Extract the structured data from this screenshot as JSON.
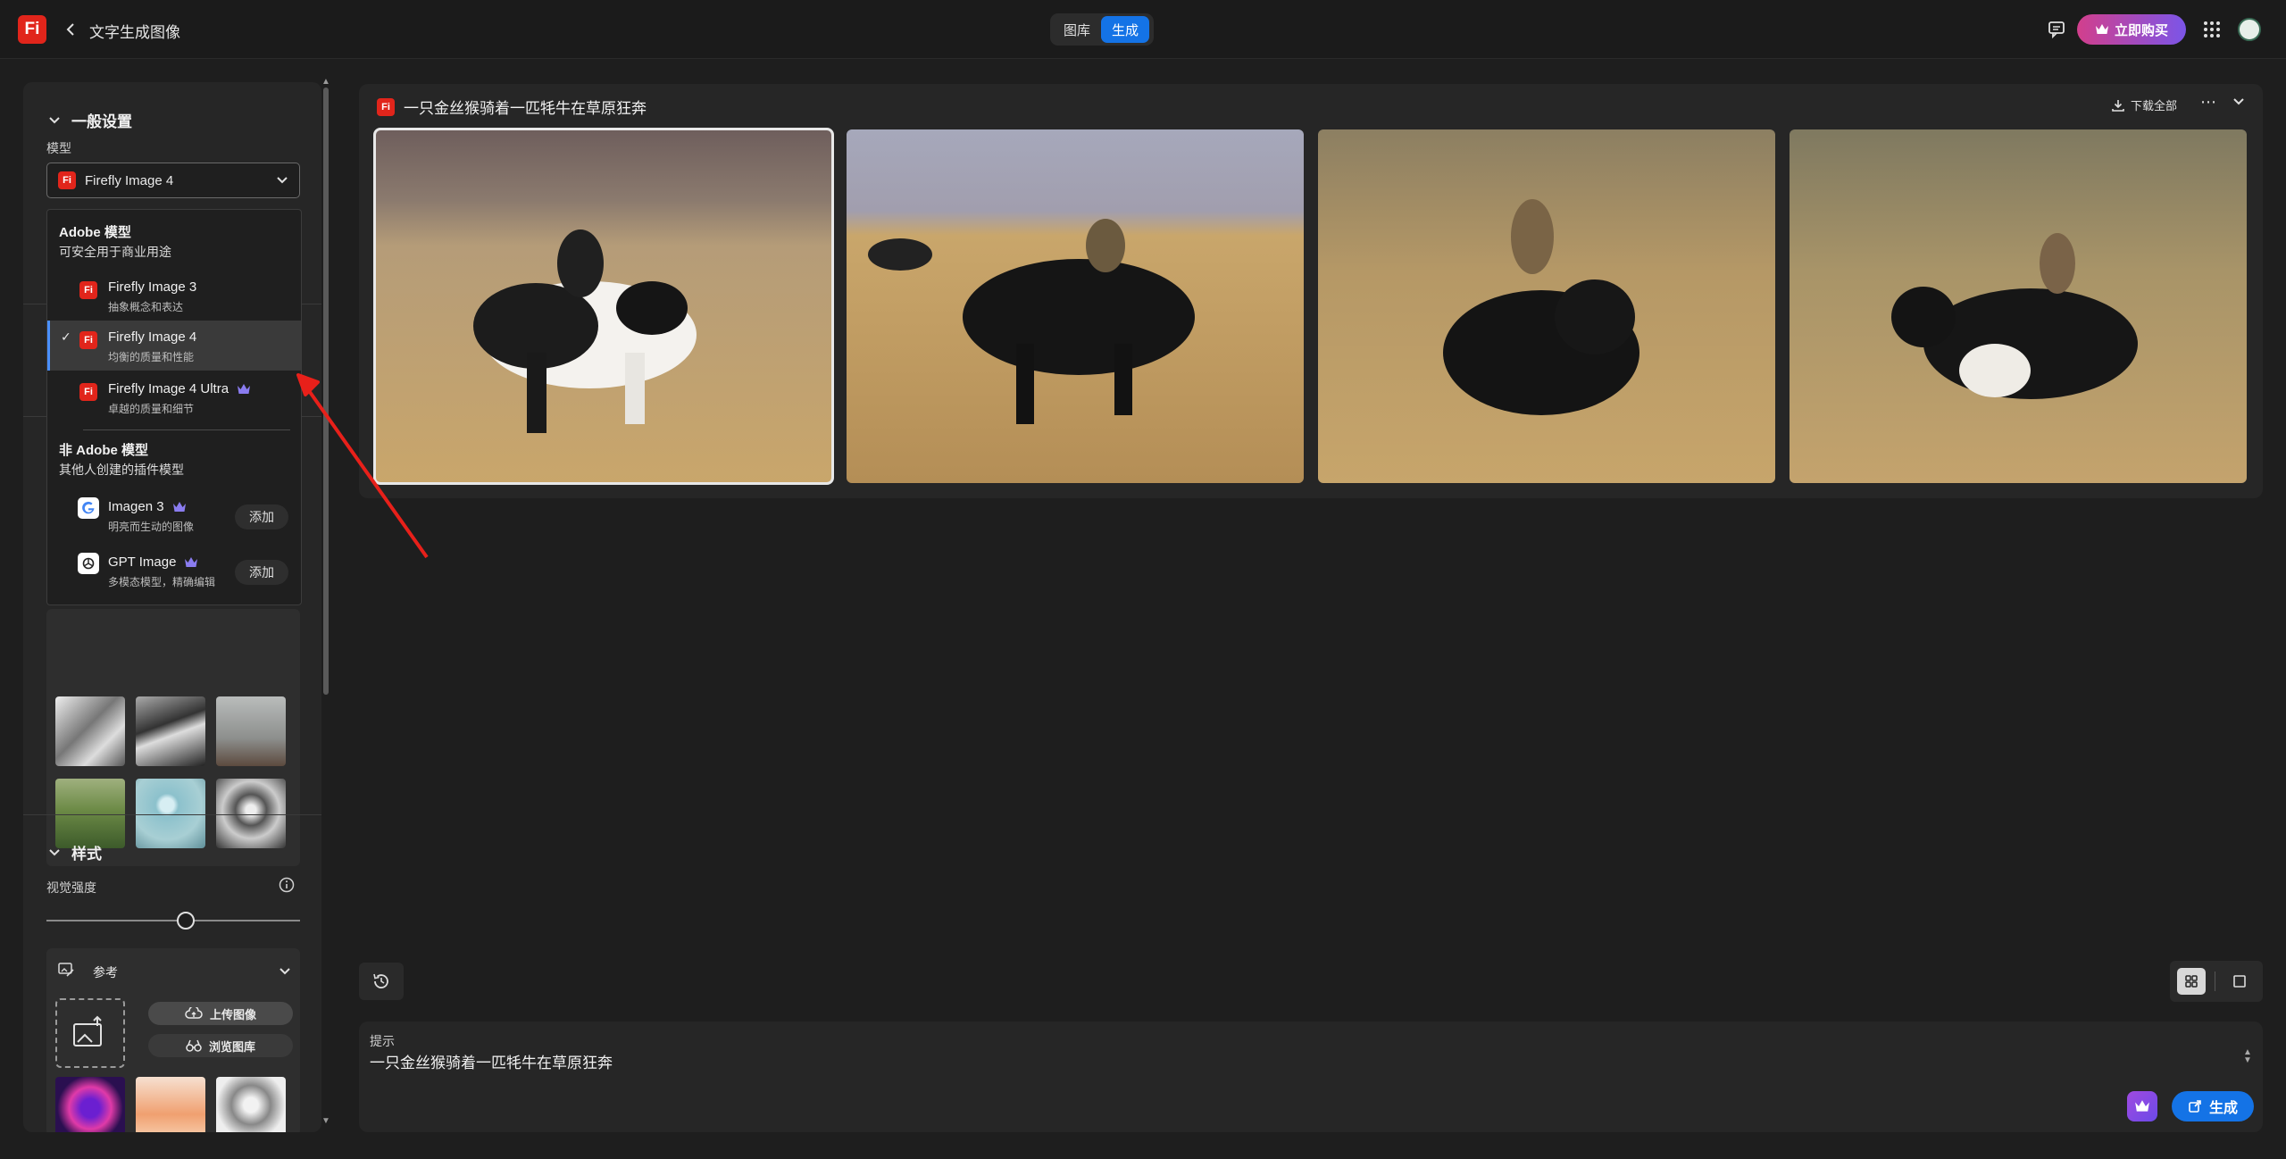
{
  "app": {
    "logo_text": "Fi",
    "title": "文字生成图像"
  },
  "nav": {
    "tabs": [
      {
        "label": "图库"
      },
      {
        "label": "生成",
        "active": true
      }
    ],
    "buy_label": "立即购买"
  },
  "sidebar": {
    "general_title": "一般设置",
    "model_label": "模型",
    "selected_model": "Firefly Image 4",
    "dropdown": {
      "adobe_heading": "Adobe 模型",
      "adobe_sub": "可安全用于商业用途",
      "adobe_models": [
        {
          "name": "Firefly Image 3",
          "desc": "抽象概念和表达"
        },
        {
          "name": "Firefly Image 4",
          "desc": "均衡的质量和性能",
          "selected": true
        },
        {
          "name": "Firefly Image 4 Ultra",
          "desc": "卓越的质量和细节",
          "premium": true
        }
      ],
      "other_heading": "非 Adobe 模型",
      "other_sub": "其他人创建的插件模型",
      "other_models": [
        {
          "name": "Imagen 3",
          "desc": "明亮而生动的图像",
          "button": "添加",
          "icon": "google-icon"
        },
        {
          "name": "GPT Image",
          "desc": "多模态模型，精确编辑",
          "button": "添加",
          "icon": "openai-icon"
        }
      ]
    },
    "style_title": "样式",
    "visual_intensity_label": "视觉强度",
    "visual_intensity_value": 0.55,
    "reference_label": "参考",
    "upload_label": "上传图像",
    "browse_label": "浏览图库"
  },
  "main": {
    "result_title": "一只金丝猴骑着一匹牦牛在草原狂奔",
    "download_all": "下载全部",
    "prompt_label": "提示",
    "prompt_text": "一只金丝猴骑着一匹牦牛在草原狂奔",
    "generate_label": "生成"
  },
  "colors": {
    "accent": "#1473e6",
    "brand": "#e1251b",
    "annotation_arrow": "#e8201a"
  }
}
